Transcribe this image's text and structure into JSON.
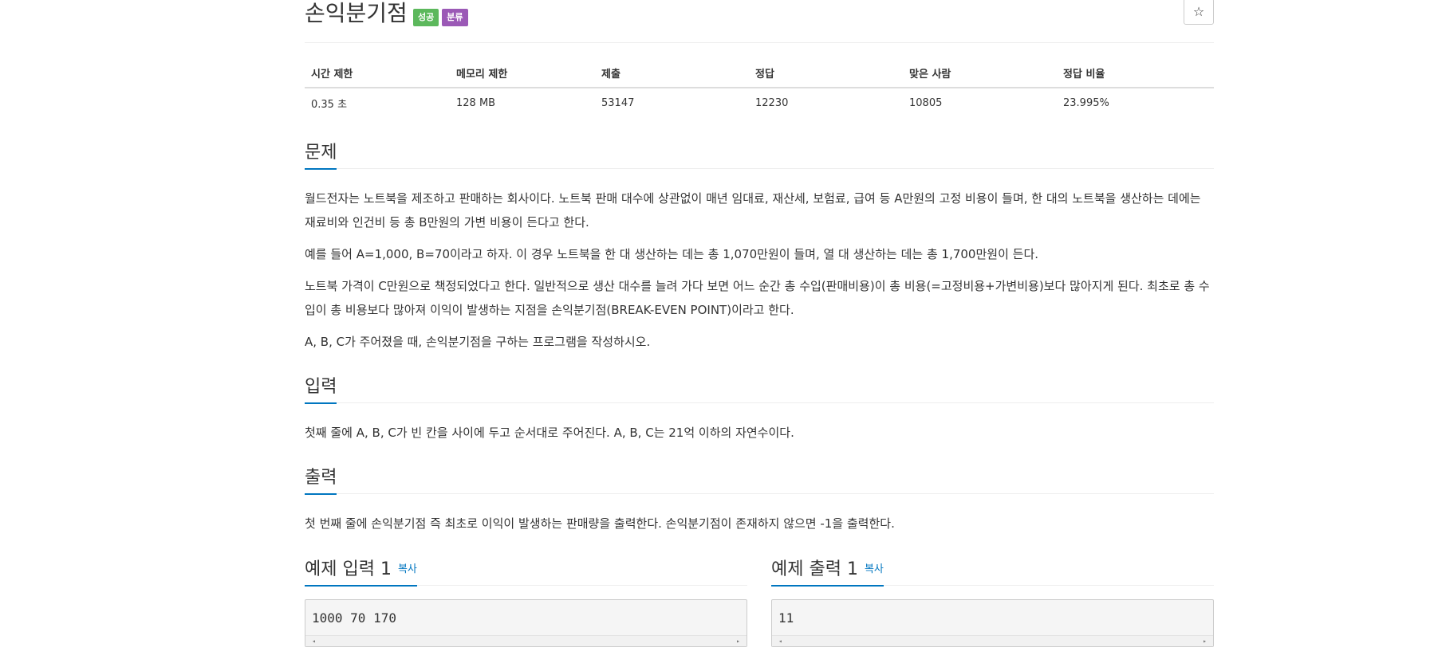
{
  "title": "손익분기점",
  "labels": {
    "success": "성공",
    "classify": "분류"
  },
  "star_icon": "☆",
  "info_table": {
    "headers": [
      "시간 제한",
      "메모리 제한",
      "제출",
      "정답",
      "맞은 사람",
      "정답 비율"
    ],
    "values": [
      "0.35 초",
      "128 MB",
      "53147",
      "12230",
      "10805",
      "23.995%"
    ]
  },
  "problem": {
    "heading": "문제",
    "paragraphs": [
      "월드전자는 노트북을 제조하고 판매하는 회사이다. 노트북 판매 대수에 상관없이 매년 임대료, 재산세, 보험료, 급여 등 A만원의 고정 비용이 들며, 한 대의 노트북을 생산하는 데에는 재료비와 인건비 등 총 B만원의 가변 비용이 든다고 한다.",
      "예를 들어 A=1,000, B=70이라고 하자. 이 경우 노트북을 한 대 생산하는 데는 총 1,070만원이 들며, 열 대 생산하는 데는 총 1,700만원이 든다.",
      "노트북 가격이 C만원으로 책정되었다고 한다. 일반적으로 생산 대수를 늘려 가다 보면 어느 순간 총 수입(판매비용)이 총 비용(=고정비용+가변비용)보다 많아지게 된다. 최초로 총 수입이 총 비용보다 많아져 이익이 발생하는 지점을 손익분기점(BREAK-EVEN POINT)이라고 한다.",
      "A, B, C가 주어졌을 때, 손익분기점을 구하는 프로그램을 작성하시오."
    ]
  },
  "input": {
    "heading": "입력",
    "text": "첫째 줄에 A, B, C가 빈 칸을 사이에 두고 순서대로 주어진다. A, B, C는 21억 이하의 자연수이다."
  },
  "output": {
    "heading": "출력",
    "text": "첫 번째 줄에 손익분기점 즉 최초로 이익이 발생하는 판매량을 출력한다. 손익분기점이 존재하지 않으면 -1을 출력한다."
  },
  "sample_input": {
    "heading": "예제 입력 1",
    "copy": "복사",
    "content": "1000 70 170"
  },
  "sample_output": {
    "heading": "예제 출력 1",
    "copy": "복사",
    "content": "11"
  },
  "scroll_left_icon": "◂",
  "scroll_right_icon": "▸"
}
